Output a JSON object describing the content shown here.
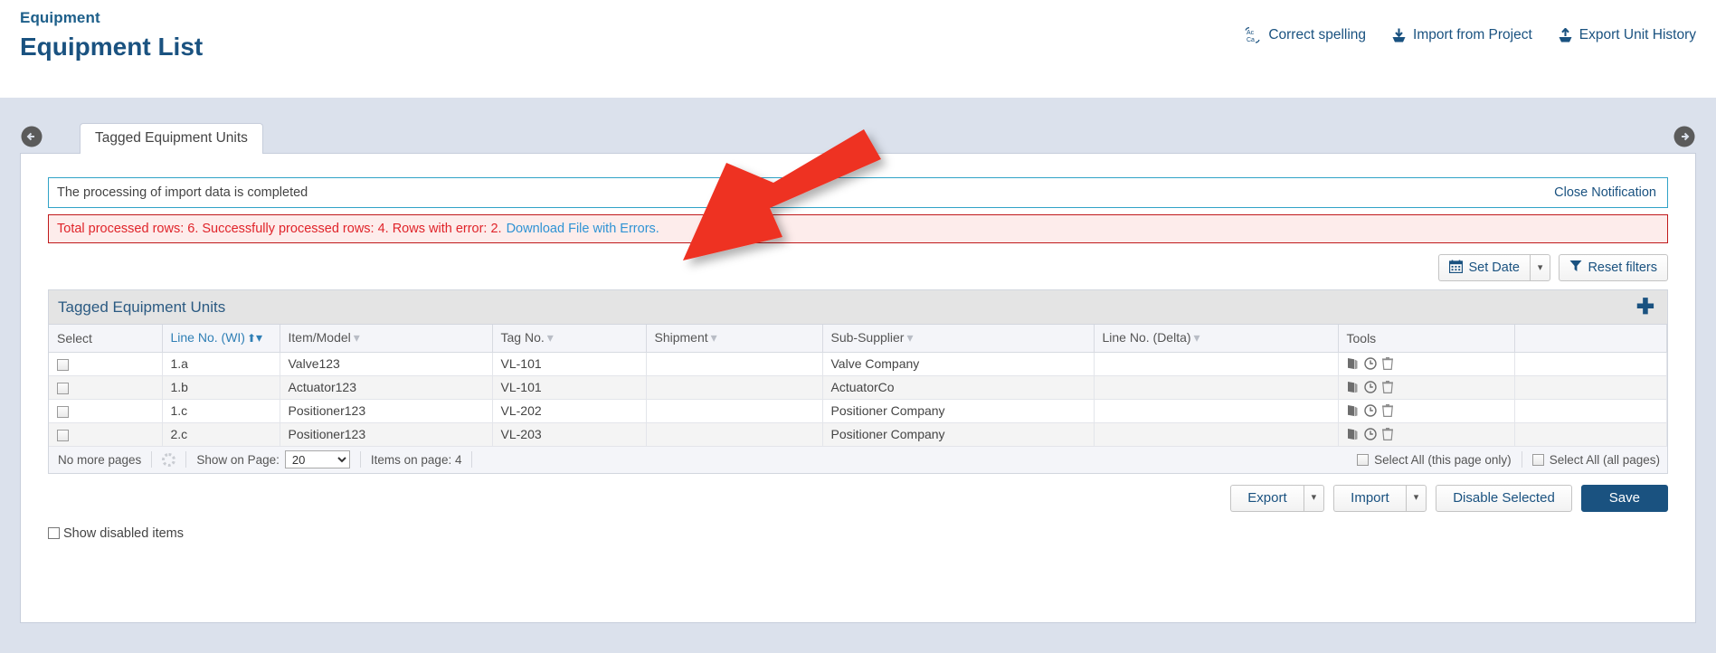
{
  "header": {
    "breadcrumb": "Equipment",
    "title": "Equipment List",
    "actions": [
      {
        "label": "Correct spelling",
        "icon": "spellcheck-icon"
      },
      {
        "label": "Import from Project",
        "icon": "import-download-icon"
      },
      {
        "label": "Export Unit History",
        "icon": "export-upload-icon"
      }
    ]
  },
  "nav": {
    "prev_icon": "arrow-left-circle-icon",
    "next_icon": "arrow-right-circle-icon"
  },
  "tabs": [
    {
      "label": "Tagged Equipment Units",
      "active": true
    }
  ],
  "notifications": {
    "info": {
      "message": "The processing of import data is completed",
      "close_label": "Close Notification"
    },
    "error": {
      "message": "Total processed rows: 6. Successfully processed rows: 4. Rows with error: 2.",
      "link_label": "Download File with Errors."
    }
  },
  "filters": {
    "set_date_label": "Set Date",
    "set_date_icon": "calendar-icon",
    "reset_filters_label": "Reset filters",
    "reset_filters_icon": "funnel-icon"
  },
  "grid": {
    "title": "Tagged Equipment Units",
    "add_icon": "plus-icon",
    "columns": [
      {
        "label": "Select",
        "filterable": false,
        "sorted": false
      },
      {
        "label": "Line No. (WI)",
        "filterable": true,
        "sorted": true,
        "sort_dir": "asc"
      },
      {
        "label": "Item/Model",
        "filterable": true,
        "sorted": false
      },
      {
        "label": "Tag No.",
        "filterable": true,
        "sorted": false
      },
      {
        "label": "Shipment",
        "filterable": true,
        "sorted": false
      },
      {
        "label": "Sub-Supplier",
        "filterable": true,
        "sorted": false
      },
      {
        "label": "Line No. (Delta)",
        "filterable": true,
        "sorted": false
      },
      {
        "label": "Tools",
        "filterable": false,
        "sorted": false
      },
      {
        "label": "",
        "filterable": false,
        "sorted": false
      }
    ],
    "rows": [
      {
        "select": "",
        "line_no_wi": "1.a",
        "item_model": "Valve123",
        "tag_no": "VL-101",
        "shipment": "",
        "sub_supplier": "Valve Company",
        "line_no_delta": ""
      },
      {
        "select": "",
        "line_no_wi": "1.b",
        "item_model": "Actuator123",
        "tag_no": "VL-101",
        "shipment": "",
        "sub_supplier": "ActuatorCo",
        "line_no_delta": ""
      },
      {
        "select": "",
        "line_no_wi": "1.c",
        "item_model": "Positioner123",
        "tag_no": "VL-202",
        "shipment": "",
        "sub_supplier": "Positioner Company",
        "line_no_delta": ""
      },
      {
        "select": "",
        "line_no_wi": "2.c",
        "item_model": "Positioner123",
        "tag_no": "VL-203",
        "shipment": "",
        "sub_supplier": "Positioner Company",
        "line_no_delta": ""
      }
    ],
    "row_tools": [
      {
        "icon": "copy-icon",
        "name": "copy-row-button"
      },
      {
        "icon": "history-clock-icon",
        "name": "history-row-button"
      },
      {
        "icon": "trash-icon",
        "name": "delete-row-button"
      }
    ],
    "footer": {
      "pages_status": "No more pages",
      "refresh_icon": "spinner-icon",
      "show_on_page_label": "Show on Page:",
      "show_on_page_value": "20",
      "show_on_page_options": [
        "20"
      ],
      "items_on_page": "Items on page: 4",
      "select_all_page_label": "Select All (this page only)",
      "select_all_pages_label": "Select All (all pages)"
    }
  },
  "actions": {
    "export_label": "Export",
    "import_label": "Import",
    "disable_selected_label": "Disable Selected",
    "save_label": "Save"
  },
  "show_disabled_label": "Show disabled items",
  "colors": {
    "brand": "#1a5280",
    "info_border": "#31a3c7",
    "error_border": "#c0191b",
    "error_bg": "#fdeceb",
    "error_text": "#e0242a",
    "link": "#2f93d4",
    "frame_bg": "#dbe1ec",
    "annotation_arrow": "#ee3124"
  }
}
